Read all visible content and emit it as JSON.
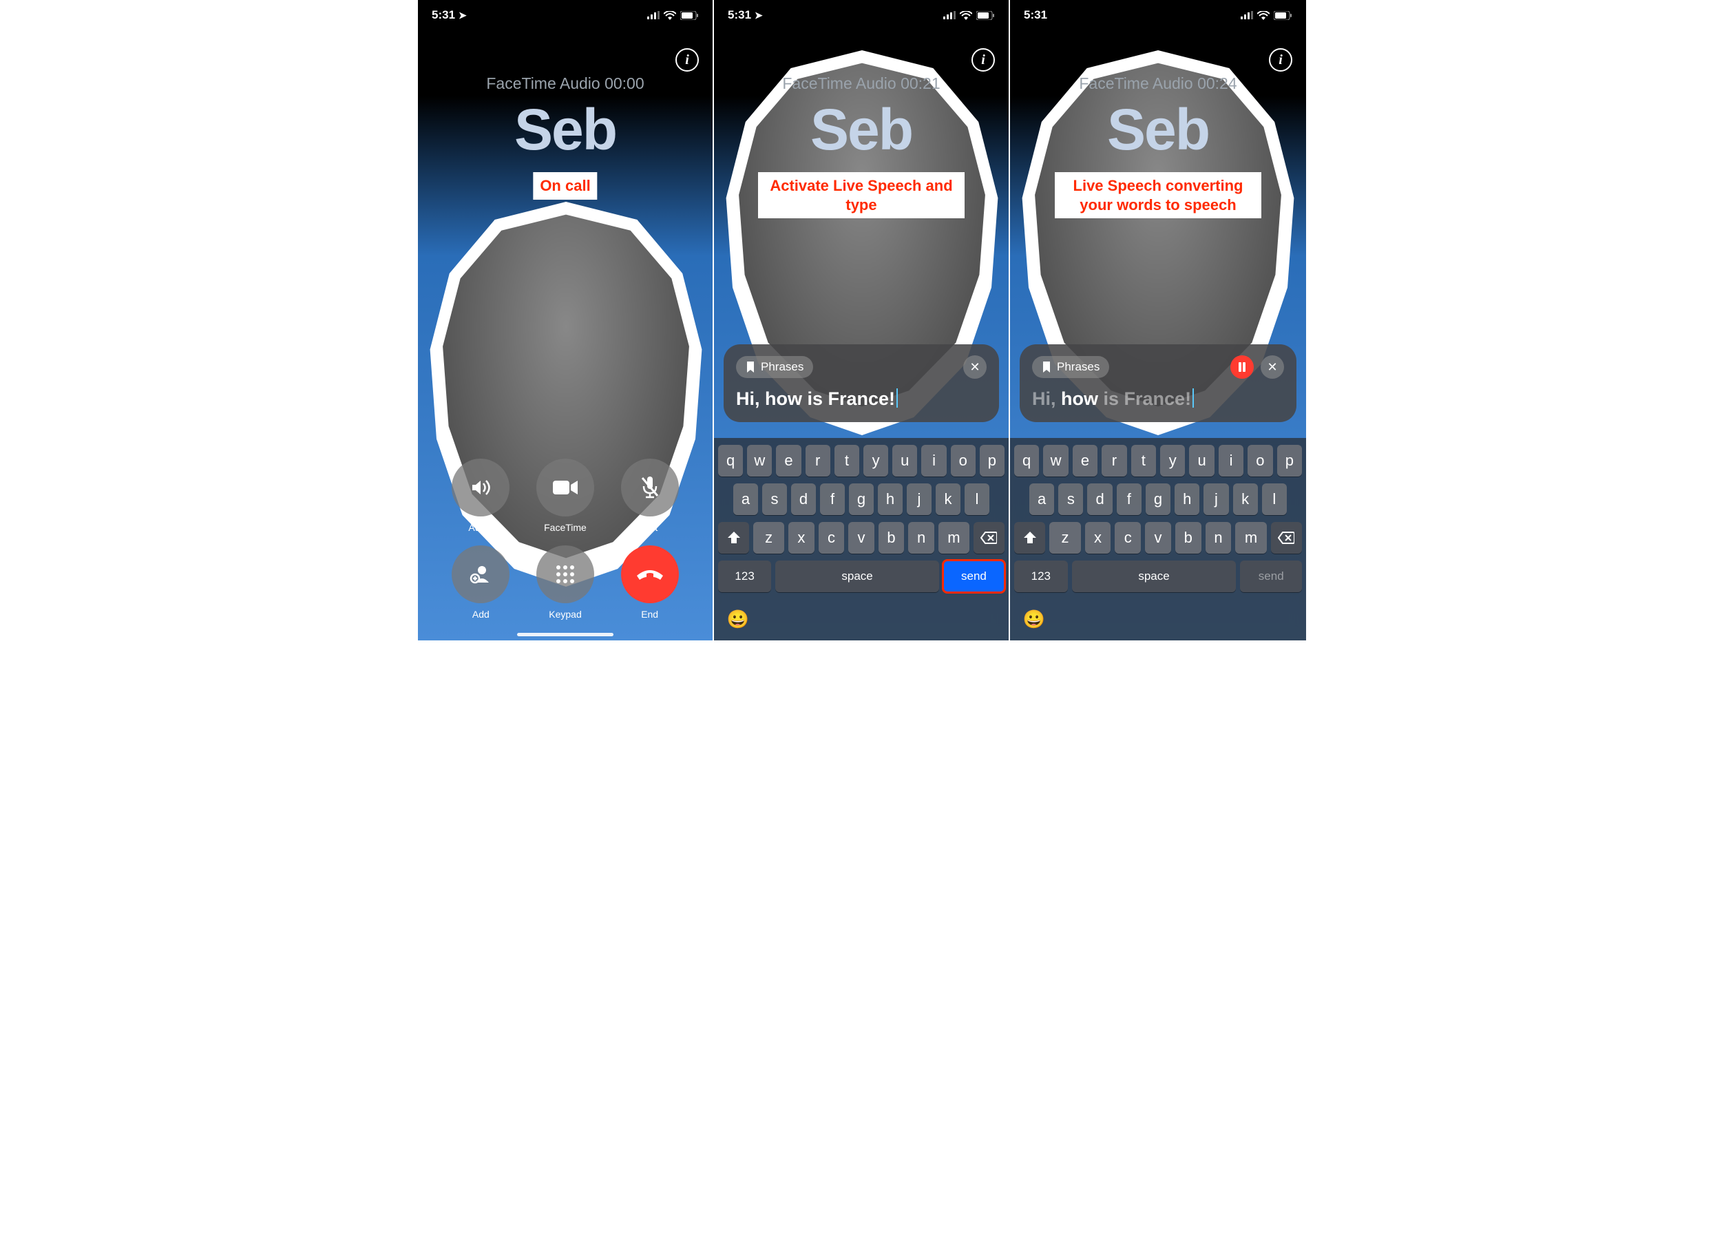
{
  "status": {
    "time": "5:31",
    "location_icon": "location-arrow",
    "signal": "signal-icon",
    "wifi": "wifi-icon",
    "battery": "battery-icon"
  },
  "screens": [
    {
      "call_type_line": "FaceTime Audio 00:00",
      "caller": "Seb",
      "annotation": "On call",
      "controls": [
        {
          "icon": "speaker-icon",
          "label": "Audio"
        },
        {
          "icon": "video-icon",
          "label": "FaceTime"
        },
        {
          "icon": "mic-off-icon",
          "label": "Mut"
        },
        {
          "icon": "add-person-icon",
          "label": "Add"
        },
        {
          "icon": "keypad-icon",
          "label": "Keypad"
        },
        {
          "icon": "hangup-icon",
          "label": "End",
          "red": true
        }
      ]
    },
    {
      "call_type_line": "FaceTime Audio 00:21",
      "caller": "Seb",
      "annotation": "Activate Live Speech and type",
      "live_speech": {
        "phrases_label": "Phrases",
        "text": "Hi, how is France!",
        "show_pause": false
      },
      "keyboard": {
        "row1": [
          "q",
          "w",
          "e",
          "r",
          "t",
          "y",
          "u",
          "i",
          "o",
          "p"
        ],
        "row2": [
          "a",
          "s",
          "d",
          "f",
          "g",
          "h",
          "j",
          "k",
          "l"
        ],
        "row3_keys": [
          "z",
          "x",
          "c",
          "v",
          "b",
          "n",
          "m"
        ],
        "num_label": "123",
        "space_label": "space",
        "send_label": "send",
        "send_active": true
      }
    },
    {
      "call_type_line": "FaceTime Audio 00:24",
      "caller": "Seb",
      "annotation": "Live Speech converting your words to speech",
      "live_speech": {
        "phrases_label": "Phrases",
        "text_parts": {
          "dim_before": "Hi, ",
          "bold": "how",
          "dim_after": " is France!"
        },
        "show_pause": true
      },
      "keyboard": {
        "row1": [
          "q",
          "w",
          "e",
          "r",
          "t",
          "y",
          "u",
          "i",
          "o",
          "p"
        ],
        "row2": [
          "a",
          "s",
          "d",
          "f",
          "g",
          "h",
          "j",
          "k",
          "l"
        ],
        "row3_keys": [
          "z",
          "x",
          "c",
          "v",
          "b",
          "n",
          "m"
        ],
        "num_label": "123",
        "space_label": "space",
        "send_label": "send",
        "send_active": false
      }
    }
  ]
}
